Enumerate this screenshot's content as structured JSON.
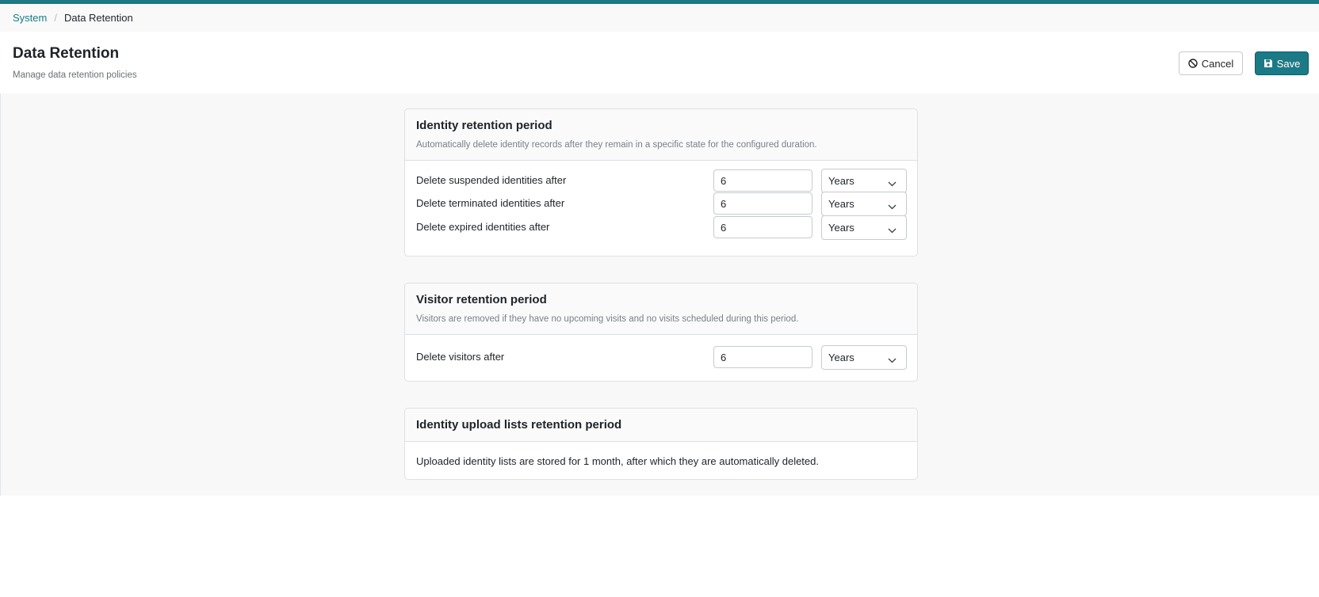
{
  "breadcrumb": {
    "parent": "System",
    "separator": "/",
    "current": "Data Retention"
  },
  "header": {
    "title": "Data Retention",
    "subtitle": "Manage data retention policies"
  },
  "actions": {
    "cancel_label": "Cancel",
    "save_label": "Save"
  },
  "colors": {
    "accent": "#1b7a85",
    "background": "#f8f8f8",
    "border": "#dde0e3"
  },
  "icons": {
    "cancel": "ban-icon",
    "save": "floppy-disk-icon",
    "dropdown": "chevron-down-icon"
  },
  "identity_card": {
    "title": "Identity retention period",
    "description": "Automatically delete identity records after they remain in a specific state for the configured duration.",
    "rows": [
      {
        "label": "Delete suspended identities after",
        "value": "6",
        "unit": "Years"
      },
      {
        "label": "Delete terminated identities after",
        "value": "6",
        "unit": "Years"
      },
      {
        "label": "Delete expired identities after",
        "value": "6",
        "unit": "Years"
      }
    ]
  },
  "visitor_card": {
    "title": "Visitor retention period",
    "description": "Visitors are removed if they have no upcoming visits and no visits scheduled during this period.",
    "rows": [
      {
        "label": "Delete visitors after",
        "value": "6",
        "unit": "Years"
      }
    ]
  },
  "upload_card": {
    "title": "Identity upload lists retention period",
    "text": "Uploaded identity lists are stored for 1 month, after which they are automatically deleted."
  }
}
